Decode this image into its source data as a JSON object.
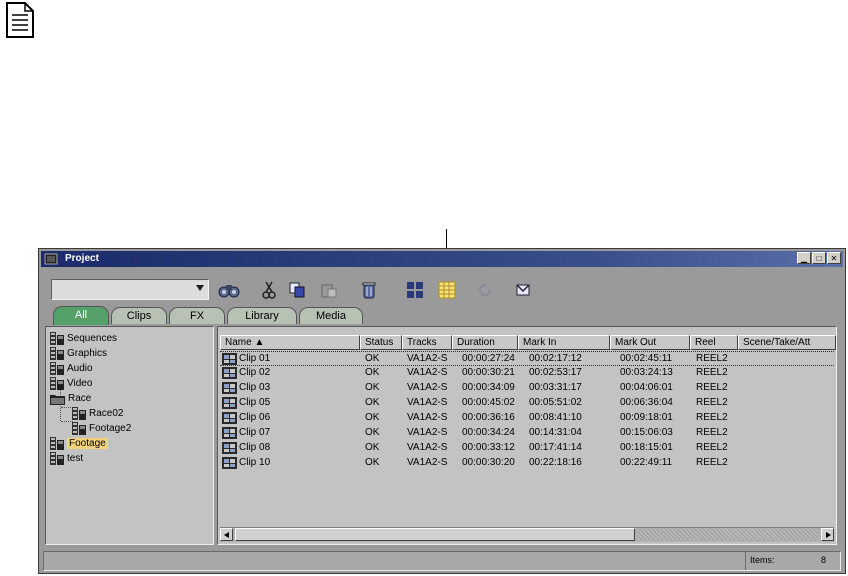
{
  "window": {
    "title": "Project"
  },
  "combo": {
    "value": ""
  },
  "toolbar": {
    "icons": [
      "binoculars-icon",
      "cut-icon",
      "copy-icon",
      "paste-icon",
      "trash-icon",
      "frame-view-icon",
      "script-view-icon",
      "refresh-icon",
      "mail-icon"
    ]
  },
  "tabs": [
    {
      "label": "All",
      "active": true
    },
    {
      "label": "Clips",
      "active": false
    },
    {
      "label": "FX",
      "active": false
    },
    {
      "label": "Library",
      "active": false
    },
    {
      "label": "Media",
      "active": false
    }
  ],
  "tree": [
    {
      "label": "Sequences",
      "type": "bin"
    },
    {
      "label": "Graphics",
      "type": "bin"
    },
    {
      "label": "Audio",
      "type": "bin"
    },
    {
      "label": "Video",
      "type": "bin"
    },
    {
      "label": "Race",
      "type": "folder"
    },
    {
      "label": "Race02",
      "type": "bin"
    },
    {
      "label": "Footage2",
      "type": "bin"
    },
    {
      "label": "Footage",
      "type": "bin",
      "selected": true
    },
    {
      "label": "test",
      "type": "bin"
    }
  ],
  "columns": [
    "Name ▲",
    "Status",
    "Tracks",
    "Duration",
    "Mark In",
    "Mark Out",
    "Reel",
    "Scene/Take/Att"
  ],
  "rows": [
    {
      "name": "Clip 01",
      "status": "OK",
      "tracks": "VA1A2-S",
      "duration": "00:00:27:24",
      "mark_in": "00:02:17:12",
      "mark_out": "00:02:45:11",
      "reel": "REEL2"
    },
    {
      "name": "Clip 02",
      "status": "OK",
      "tracks": "VA1A2-S",
      "duration": "00:00:30:21",
      "mark_in": "00:02:53:17",
      "mark_out": "00:03:24:13",
      "reel": "REEL2"
    },
    {
      "name": "Clip 03",
      "status": "OK",
      "tracks": "VA1A2-S",
      "duration": "00:00:34:09",
      "mark_in": "00:03:31:17",
      "mark_out": "00:04:06:01",
      "reel": "REEL2"
    },
    {
      "name": "Clip 05",
      "status": "OK",
      "tracks": "VA1A2-S",
      "duration": "00:00:45:02",
      "mark_in": "00:05:51:02",
      "mark_out": "00:06:36:04",
      "reel": "REEL2"
    },
    {
      "name": "Clip 06",
      "status": "OK",
      "tracks": "VA1A2-S",
      "duration": "00:00:36:16",
      "mark_in": "00:08:41:10",
      "mark_out": "00:09:18:01",
      "reel": "REEL2"
    },
    {
      "name": "Clip 07",
      "status": "OK",
      "tracks": "VA1A2-S",
      "duration": "00:00:34:24",
      "mark_in": "00:14:31:04",
      "mark_out": "00:15:06:03",
      "reel": "REEL2"
    },
    {
      "name": "Clip 08",
      "status": "OK",
      "tracks": "VA1A2-S",
      "duration": "00:00:33:12",
      "mark_in": "00:17:41:14",
      "mark_out": "00:18:15:01",
      "reel": "REEL2"
    },
    {
      "name": "Clip 10",
      "status": "OK",
      "tracks": "VA1A2-S",
      "duration": "00:00:30:20",
      "mark_in": "00:22:18:16",
      "mark_out": "00:22:49:11",
      "reel": "REEL2"
    }
  ],
  "selected_row": 0,
  "status": {
    "items_label": "Items:",
    "items_count": "8"
  },
  "colors": {
    "active_tab": "#56a06a",
    "selection": "#f2d27a",
    "titlebar": "#1a2a6a"
  }
}
